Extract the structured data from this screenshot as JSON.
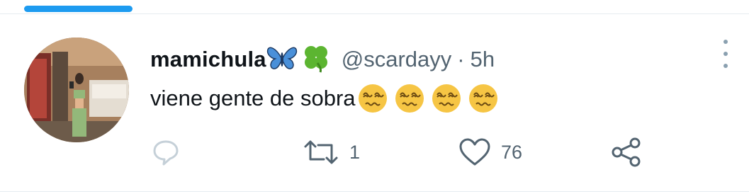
{
  "tweet": {
    "display_name": "mamichula",
    "handle": "@scardayy",
    "separator": "·",
    "time": "5h",
    "text": "viene gente de sobra"
  },
  "name_emojis": [
    {
      "name": "butterfly-icon",
      "color": "#4a90d9"
    },
    {
      "name": "four-leaf-clover-icon",
      "color": "#5cb531"
    }
  ],
  "text_emojis": [
    "dizzy-face-icon",
    "dizzy-face-icon",
    "dizzy-face-icon",
    "dizzy-face-icon"
  ],
  "actions": {
    "reply_count": "",
    "retweet_count": "1",
    "like_count": "76"
  },
  "colors": {
    "accent": "#1d9bf0",
    "text_primary": "#0f1419",
    "text_secondary": "#536471",
    "icon": "#536471",
    "reply_icon": "#c5d0d8",
    "emoji_face": "#f6c544"
  }
}
